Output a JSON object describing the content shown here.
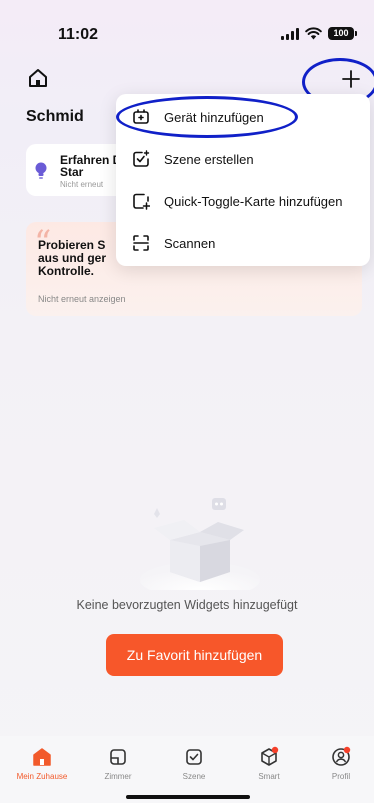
{
  "status_bar": {
    "time": "11:02",
    "battery": "100"
  },
  "header": {
    "home_title": "Schmid"
  },
  "cards": {
    "diy": {
      "title": "Erfahren DIY-Star",
      "subtitle": "Nicht erneut"
    },
    "try": {
      "title": "Probieren S aus und ger Kontrolle.",
      "subtitle": "Nicht erneut anzeigen"
    }
  },
  "menu": {
    "items": [
      {
        "label": "Gerät hinzufügen",
        "icon": "add-device-icon"
      },
      {
        "label": "Szene erstellen",
        "icon": "create-scene-icon"
      },
      {
        "label": "Quick-Toggle-Karte hinzufügen",
        "icon": "quick-toggle-icon"
      },
      {
        "label": "Scannen",
        "icon": "scan-icon"
      }
    ]
  },
  "empty_state": {
    "text": "Keine bevorzugten Widgets hinzugefügt",
    "button_label": "Zu Favorit hinzufügen"
  },
  "tabbar": {
    "active_color": "#f25a2b",
    "tabs": [
      {
        "label": "Mein Zuhause",
        "icon": "home-tab-icon"
      },
      {
        "label": "Zimmer",
        "icon": "room-tab-icon"
      },
      {
        "label": "Szene",
        "icon": "scene-tab-icon"
      },
      {
        "label": "Smart",
        "icon": "smart-tab-icon"
      },
      {
        "label": "Profil",
        "icon": "profile-tab-icon"
      }
    ]
  },
  "colors": {
    "accent": "#f7572a",
    "annotation": "#1020c8"
  }
}
